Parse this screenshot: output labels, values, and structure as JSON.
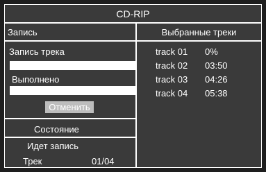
{
  "window": {
    "title": "CD-RIP"
  },
  "left": {
    "header": "Запись",
    "record_track_label": "Запись трека",
    "record_track_progress": 0,
    "done_label": "Выполнено",
    "done_progress": 0,
    "cancel_label": "Отменить",
    "state_header": "Состояние",
    "state_value": "Идет запись",
    "track_label": "Трек",
    "track_value": "01/04"
  },
  "right": {
    "header": "Выбранные треки",
    "tracks": [
      {
        "name": "track 01",
        "value": "0%"
      },
      {
        "name": "track 02",
        "value": "03:50"
      },
      {
        "name": "track 03",
        "value": "04:26"
      },
      {
        "name": "track 04",
        "value": "05:38"
      }
    ]
  }
}
